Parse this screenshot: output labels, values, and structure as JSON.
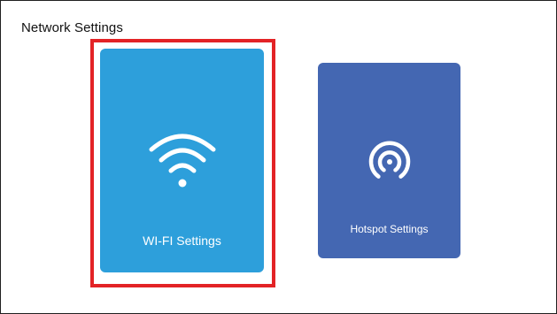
{
  "header": {
    "title": "Network Settings"
  },
  "tiles": [
    {
      "label": "WI-FI Settings",
      "icon": "wifi-icon",
      "color": "#2d9fdb",
      "selected": true
    },
    {
      "label": "Hotspot Settings",
      "icon": "hotspot-icon",
      "color": "#4467b2",
      "selected": false
    }
  ],
  "colors": {
    "focus_border": "#e32326",
    "background": "#ffffff",
    "label_text": "#ffffff"
  }
}
